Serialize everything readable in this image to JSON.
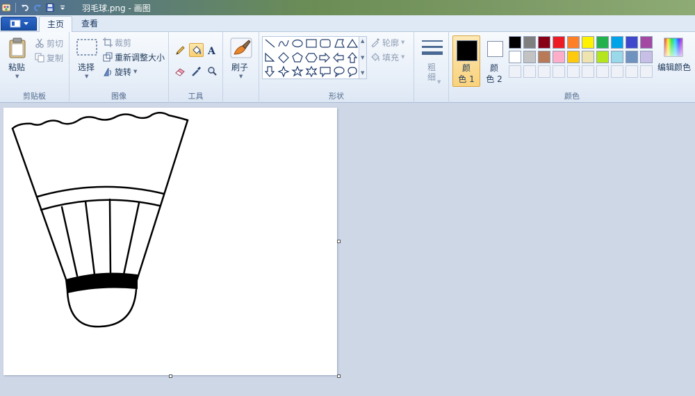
{
  "window": {
    "title": "羽毛球.png - 画图"
  },
  "tabs": [
    {
      "label": "主页",
      "active": true
    },
    {
      "label": "查看",
      "active": false
    }
  ],
  "clipboard": {
    "group_label": "剪贴板",
    "paste_label": "粘贴",
    "cut_label": "剪切",
    "copy_label": "复制"
  },
  "image": {
    "group_label": "图像",
    "select_label": "选择",
    "crop_label": "裁剪",
    "resize_label": "重新调整大小",
    "rotate_label": "旋转"
  },
  "tools": {
    "group_label": "工具",
    "items": [
      "pencil-icon",
      "fill-icon",
      "text-icon",
      "eraser-icon",
      "color-picker-icon",
      "magnifier-icon"
    ],
    "selected": "fill-icon"
  },
  "brushes": {
    "label": "刷子"
  },
  "shapes": {
    "group_label": "形状",
    "outline_label": "轮廓",
    "fill_label": "填充"
  },
  "size": {
    "label_line1": "粗",
    "label_line2": "细"
  },
  "colors": {
    "group_label": "颜色",
    "color1": {
      "label_line1": "颜",
      "label_line2": "色 1",
      "value": "#000000"
    },
    "color2": {
      "label_line1": "颜",
      "label_line2": "色 2",
      "value": "#ffffff"
    },
    "edit_label": "编辑颜色",
    "palette_row1": [
      "#000000",
      "#7f7f7f",
      "#880015",
      "#ed1c24",
      "#ff7f27",
      "#fff200",
      "#22b14c",
      "#00a2e8",
      "#3f48cc",
      "#a349a4"
    ],
    "palette_row2": [
      "#ffffff",
      "#c3c3c3",
      "#b97a57",
      "#ffaec9",
      "#ffc90e",
      "#efe4b0",
      "#b5e61d",
      "#99d9ea",
      "#7092be",
      "#c8bfe7"
    ]
  },
  "canvas_image": {
    "subject": "badminton-shuttlecock-drawing"
  }
}
